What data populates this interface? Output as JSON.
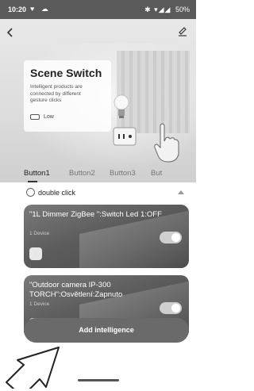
{
  "status_bar": {
    "time": "10:20",
    "left_icons": "♥ ☁",
    "right_symbols": "✱ ▾◢◢",
    "battery": "50%"
  },
  "header": {
    "back_icon": "chevron-left-icon",
    "edit_icon": "pencil-icon"
  },
  "scene": {
    "title": "Scene Switch",
    "description": "Intelligent products are connected by different gesture clicks",
    "level": "Low"
  },
  "tabs": [
    {
      "label": "Button1",
      "active": true
    },
    {
      "label": "Button2",
      "active": false
    },
    {
      "label": "Button3",
      "active": false
    },
    {
      "label": "But",
      "active": false
    }
  ],
  "trigger": {
    "label": "double click",
    "icon": "gesture-icon"
  },
  "actions": [
    {
      "title": "\"1L Dimmer ZigBee \":Switch Led 1:OFF",
      "sub": "1 Device",
      "enabled": true
    },
    {
      "title": "\"Outdoor camera IP-300 TORCH\":Osvětlení:Zapnuto",
      "sub": "1 Device",
      "enabled": true
    }
  ],
  "add_button": {
    "label": "Add intelligence"
  },
  "colors": {
    "status_bar": "#5a5a5a",
    "card": "#5c5c5c",
    "button": "#6a6a6a"
  }
}
